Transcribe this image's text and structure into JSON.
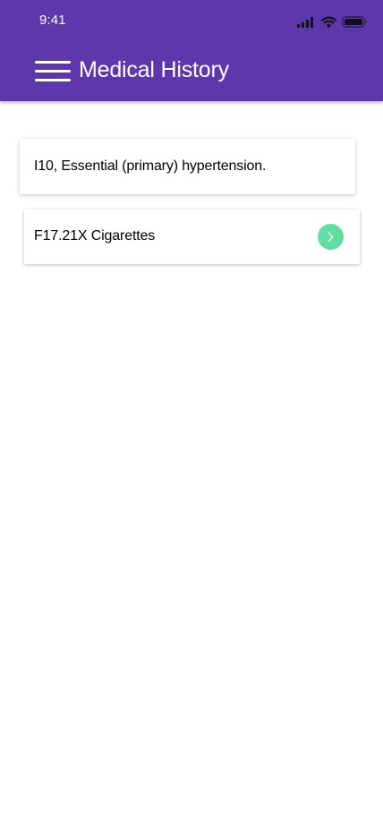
{
  "status_bar": {
    "time": "9:41",
    "icons": [
      "signal-icon",
      "wifi-icon",
      "battery-icon"
    ]
  },
  "header": {
    "title": "Medical History",
    "menu_icon": "hamburger-menu-icon"
  },
  "history": {
    "items": [
      {
        "label": "I10, Essential (primary) hypertension."
      },
      {
        "label": "F17.21X Cigarettes",
        "action_icon": "chevron-right-icon"
      }
    ]
  },
  "colors": {
    "header_background": "#5e37ad",
    "header_text": "#ffffff",
    "accent_button": "#60dda0",
    "card_background": "#ffffff",
    "page_background": "#ffffff"
  }
}
